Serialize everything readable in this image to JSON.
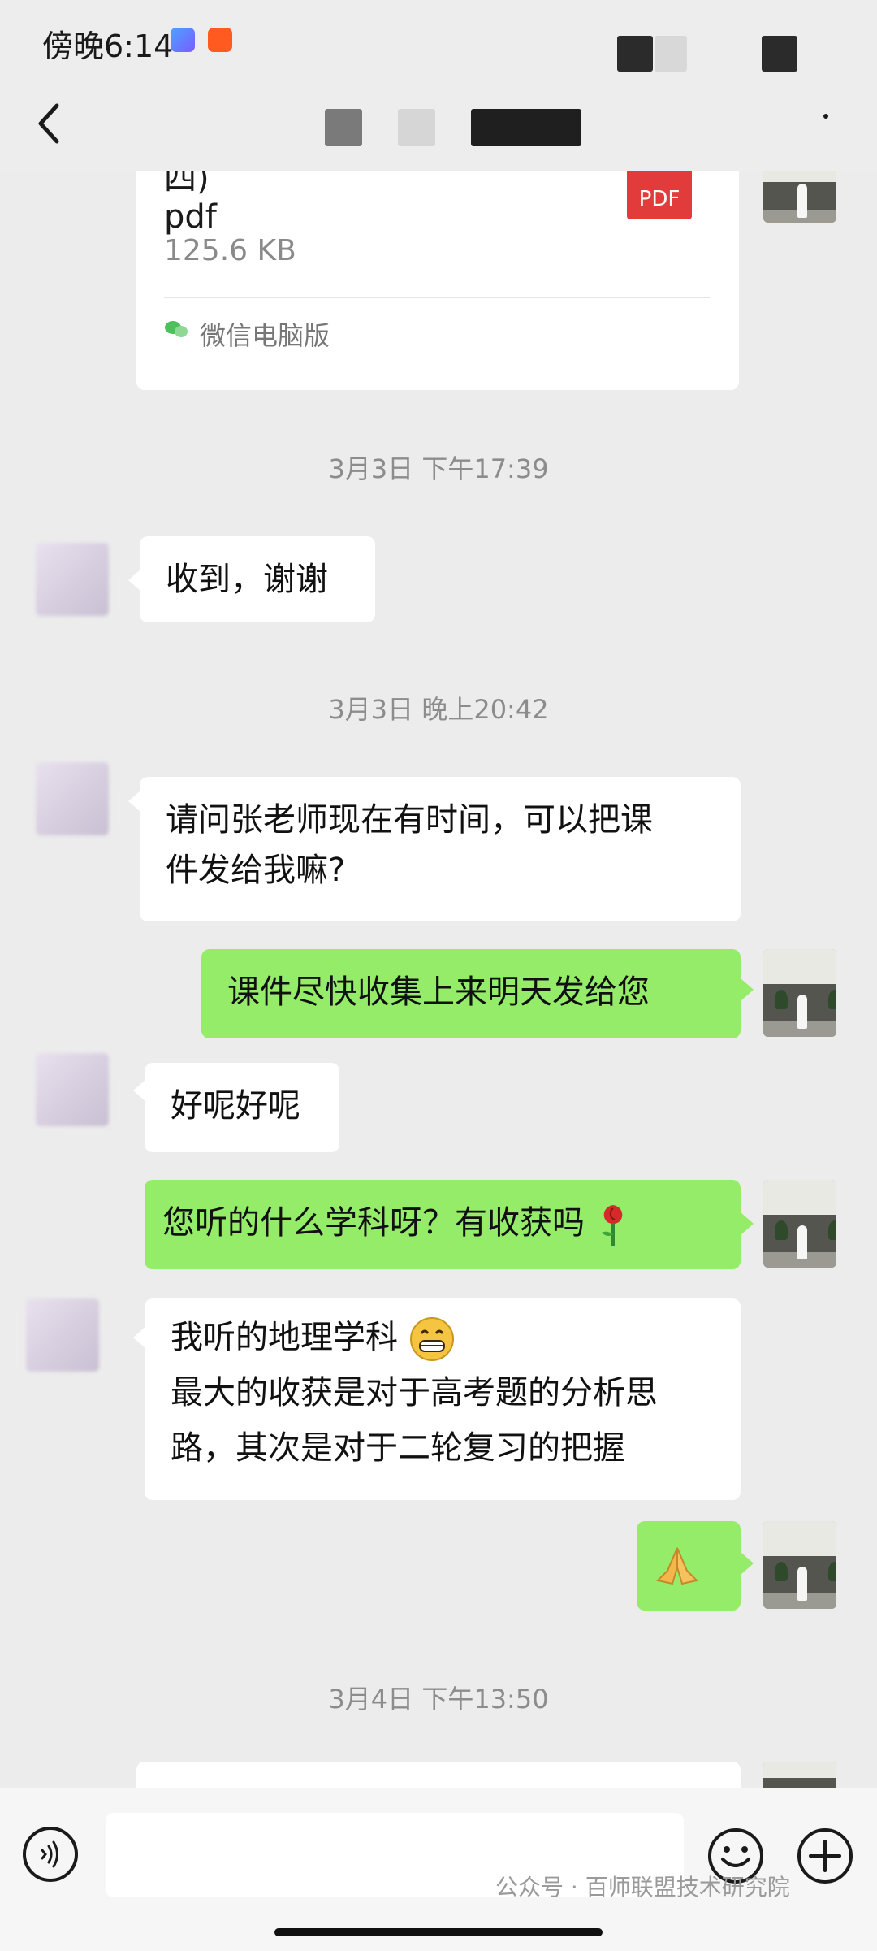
{
  "status_bar": {
    "time": "傍晚6:14"
  },
  "chat": {
    "file_message": {
      "name_fragment": "四)",
      "name_ext": "pdf",
      "size": "125.6 KB",
      "icon_label": "PDF",
      "source": "微信电脑版"
    },
    "timestamps": [
      "3月3日 下午17:39",
      "3月3日 晚上20:42",
      "3月4日 下午13:50"
    ],
    "messages": [
      {
        "side": "in",
        "text": "收到，谢谢"
      },
      {
        "side": "in",
        "lines": [
          "请问张老师现在有时间，可以把课",
          "件发给我嘛?"
        ]
      },
      {
        "side": "out",
        "text": "课件尽快收集上来明天发给您"
      },
      {
        "side": "in",
        "text": "好呢好呢"
      },
      {
        "side": "out",
        "text": "您听的什么学科呀？有收获吗",
        "emoji": "rose"
      },
      {
        "side": "in",
        "lines": [
          "我听的地理学科",
          "最大的收获是对于高考题的分析思",
          "路，其次是对于二轮复习的把握"
        ],
        "emoji": "grinning-face"
      },
      {
        "side": "out",
        "emoji": "pray"
      }
    ]
  },
  "input_bar": {
    "placeholder": ""
  },
  "watermark": "公众号 · 百师联盟技术研究院",
  "icons": [
    "back-chevron-icon",
    "more-icon",
    "voice-icon",
    "emoji-icon",
    "plus-icon",
    "wechat-icon",
    "pdf-icon"
  ],
  "colors": {
    "outgoing_bubble": "#95ec69",
    "incoming_bubble": "#ffffff",
    "background": "#ececec"
  }
}
